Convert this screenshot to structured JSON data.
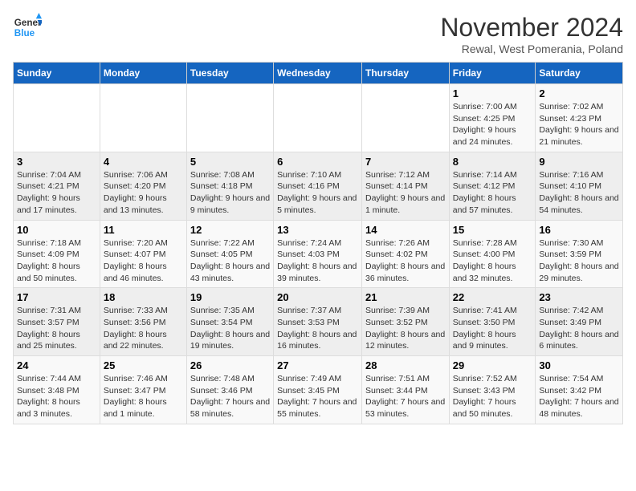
{
  "logo": {
    "line1": "General",
    "line2": "Blue"
  },
  "title": "November 2024",
  "subtitle": "Rewal, West Pomerania, Poland",
  "days_of_week": [
    "Sunday",
    "Monday",
    "Tuesday",
    "Wednesday",
    "Thursday",
    "Friday",
    "Saturday"
  ],
  "weeks": [
    [
      {
        "day": "",
        "info": ""
      },
      {
        "day": "",
        "info": ""
      },
      {
        "day": "",
        "info": ""
      },
      {
        "day": "",
        "info": ""
      },
      {
        "day": "",
        "info": ""
      },
      {
        "day": "1",
        "info": "Sunrise: 7:00 AM\nSunset: 4:25 PM\nDaylight: 9 hours and 24 minutes."
      },
      {
        "day": "2",
        "info": "Sunrise: 7:02 AM\nSunset: 4:23 PM\nDaylight: 9 hours and 21 minutes."
      }
    ],
    [
      {
        "day": "3",
        "info": "Sunrise: 7:04 AM\nSunset: 4:21 PM\nDaylight: 9 hours and 17 minutes."
      },
      {
        "day": "4",
        "info": "Sunrise: 7:06 AM\nSunset: 4:20 PM\nDaylight: 9 hours and 13 minutes."
      },
      {
        "day": "5",
        "info": "Sunrise: 7:08 AM\nSunset: 4:18 PM\nDaylight: 9 hours and 9 minutes."
      },
      {
        "day": "6",
        "info": "Sunrise: 7:10 AM\nSunset: 4:16 PM\nDaylight: 9 hours and 5 minutes."
      },
      {
        "day": "7",
        "info": "Sunrise: 7:12 AM\nSunset: 4:14 PM\nDaylight: 9 hours and 1 minute."
      },
      {
        "day": "8",
        "info": "Sunrise: 7:14 AM\nSunset: 4:12 PM\nDaylight: 8 hours and 57 minutes."
      },
      {
        "day": "9",
        "info": "Sunrise: 7:16 AM\nSunset: 4:10 PM\nDaylight: 8 hours and 54 minutes."
      }
    ],
    [
      {
        "day": "10",
        "info": "Sunrise: 7:18 AM\nSunset: 4:09 PM\nDaylight: 8 hours and 50 minutes."
      },
      {
        "day": "11",
        "info": "Sunrise: 7:20 AM\nSunset: 4:07 PM\nDaylight: 8 hours and 46 minutes."
      },
      {
        "day": "12",
        "info": "Sunrise: 7:22 AM\nSunset: 4:05 PM\nDaylight: 8 hours and 43 minutes."
      },
      {
        "day": "13",
        "info": "Sunrise: 7:24 AM\nSunset: 4:03 PM\nDaylight: 8 hours and 39 minutes."
      },
      {
        "day": "14",
        "info": "Sunrise: 7:26 AM\nSunset: 4:02 PM\nDaylight: 8 hours and 36 minutes."
      },
      {
        "day": "15",
        "info": "Sunrise: 7:28 AM\nSunset: 4:00 PM\nDaylight: 8 hours and 32 minutes."
      },
      {
        "day": "16",
        "info": "Sunrise: 7:30 AM\nSunset: 3:59 PM\nDaylight: 8 hours and 29 minutes."
      }
    ],
    [
      {
        "day": "17",
        "info": "Sunrise: 7:31 AM\nSunset: 3:57 PM\nDaylight: 8 hours and 25 minutes."
      },
      {
        "day": "18",
        "info": "Sunrise: 7:33 AM\nSunset: 3:56 PM\nDaylight: 8 hours and 22 minutes."
      },
      {
        "day": "19",
        "info": "Sunrise: 7:35 AM\nSunset: 3:54 PM\nDaylight: 8 hours and 19 minutes."
      },
      {
        "day": "20",
        "info": "Sunrise: 7:37 AM\nSunset: 3:53 PM\nDaylight: 8 hours and 16 minutes."
      },
      {
        "day": "21",
        "info": "Sunrise: 7:39 AM\nSunset: 3:52 PM\nDaylight: 8 hours and 12 minutes."
      },
      {
        "day": "22",
        "info": "Sunrise: 7:41 AM\nSunset: 3:50 PM\nDaylight: 8 hours and 9 minutes."
      },
      {
        "day": "23",
        "info": "Sunrise: 7:42 AM\nSunset: 3:49 PM\nDaylight: 8 hours and 6 minutes."
      }
    ],
    [
      {
        "day": "24",
        "info": "Sunrise: 7:44 AM\nSunset: 3:48 PM\nDaylight: 8 hours and 3 minutes."
      },
      {
        "day": "25",
        "info": "Sunrise: 7:46 AM\nSunset: 3:47 PM\nDaylight: 8 hours and 1 minute."
      },
      {
        "day": "26",
        "info": "Sunrise: 7:48 AM\nSunset: 3:46 PM\nDaylight: 7 hours and 58 minutes."
      },
      {
        "day": "27",
        "info": "Sunrise: 7:49 AM\nSunset: 3:45 PM\nDaylight: 7 hours and 55 minutes."
      },
      {
        "day": "28",
        "info": "Sunrise: 7:51 AM\nSunset: 3:44 PM\nDaylight: 7 hours and 53 minutes."
      },
      {
        "day": "29",
        "info": "Sunrise: 7:52 AM\nSunset: 3:43 PM\nDaylight: 7 hours and 50 minutes."
      },
      {
        "day": "30",
        "info": "Sunrise: 7:54 AM\nSunset: 3:42 PM\nDaylight: 7 hours and 48 minutes."
      }
    ]
  ]
}
